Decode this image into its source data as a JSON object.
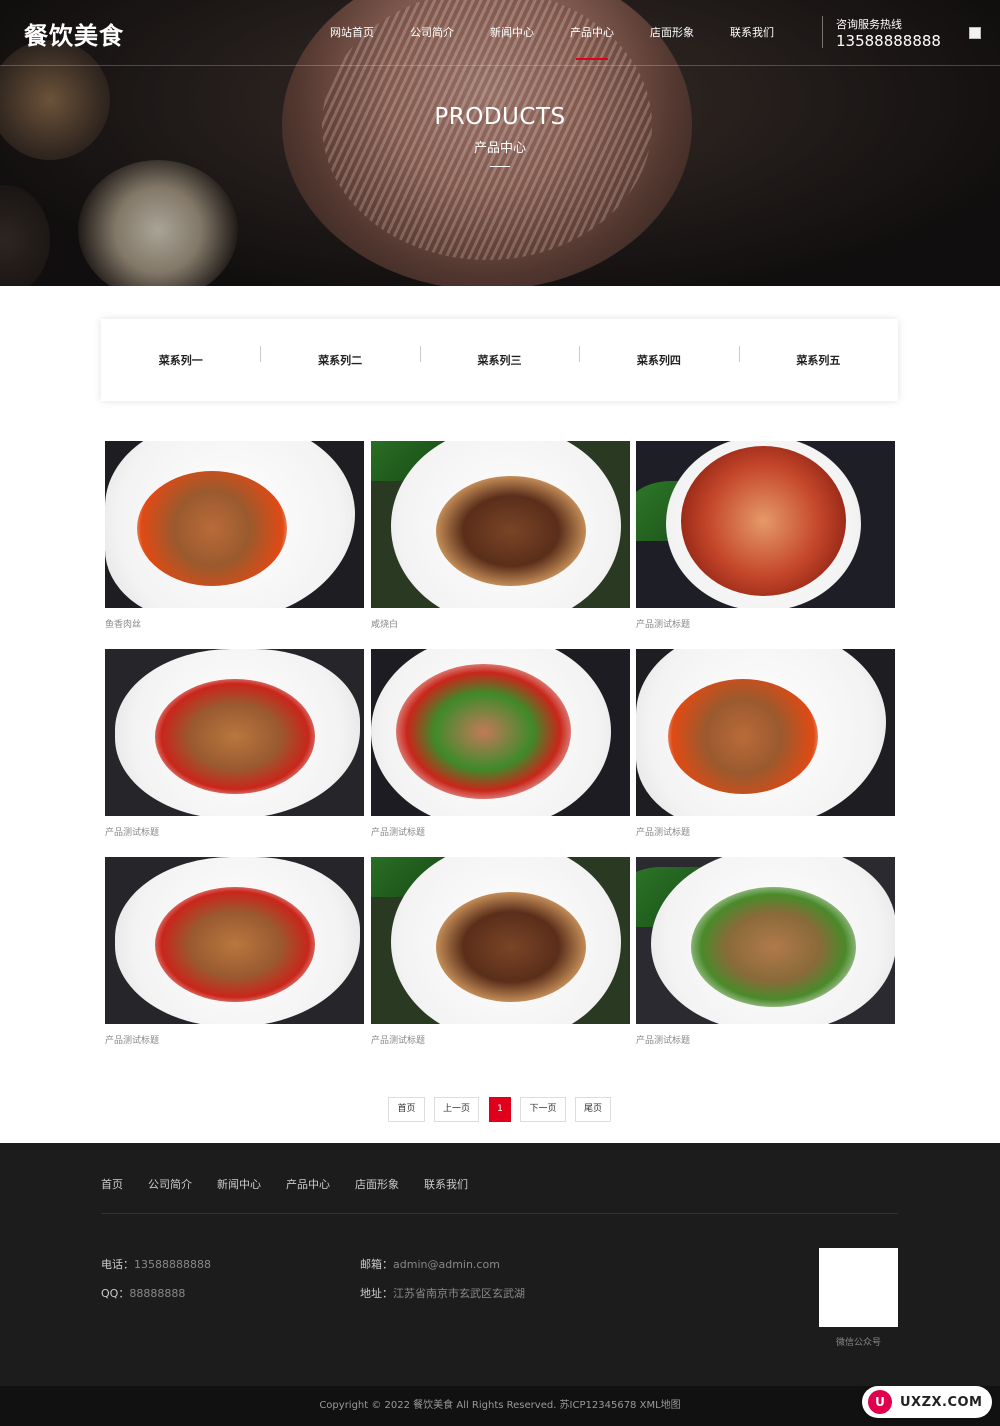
{
  "header": {
    "logo": "餐饮美食",
    "nav": [
      "网站首页",
      "公司简介",
      "新闻中心",
      "产品中心",
      "店面形象",
      "联系我们"
    ],
    "active_nav": "产品中心",
    "hotline_label": "咨询服务热线",
    "hotline_number": "13588888888"
  },
  "banner": {
    "title": "PRODUCTS",
    "subtitle": "产品中心"
  },
  "categories": [
    "菜系列一",
    "菜系列二",
    "菜系列三",
    "菜系列四",
    "菜系列五"
  ],
  "products": [
    {
      "title": "鱼香肉丝",
      "image": "shredded-pork-dish"
    },
    {
      "title": "咸烧白",
      "image": "braised-pork-belly-dish"
    },
    {
      "title": "产品测试标题",
      "image": "mapo-tofu-dish"
    },
    {
      "title": "产品测试标题",
      "image": "stir-fried-pork-peppers-dish"
    },
    {
      "title": "产品测试标题",
      "image": "pig-ear-peppers-dish"
    },
    {
      "title": "产品测试标题",
      "image": "shredded-pork-dish"
    },
    {
      "title": "产品测试标题",
      "image": "stir-fried-pork-peppers-dish"
    },
    {
      "title": "产品测试标题",
      "image": "braised-pork-belly-dish"
    },
    {
      "title": "产品测试标题",
      "image": "minced-pork-peppers-dish"
    }
  ],
  "pagination": {
    "first": "首页",
    "prev": "上一页",
    "current": "1",
    "next": "下一页",
    "last": "尾页"
  },
  "footer": {
    "nav": [
      "首页",
      "公司简介",
      "新闻中心",
      "产品中心",
      "店面形象",
      "联系我们"
    ],
    "phone_label": "电话：",
    "phone": "13588888888",
    "qq_label": "QQ：",
    "qq": "88888888",
    "email_label": "邮箱：",
    "email": "admin@admin.com",
    "address_label": "地址：",
    "address": "江苏省南京市玄武区玄武湖",
    "qr_label": "微信公众号",
    "copyright": "Copyright © 2022 餐饮美食 All Rights Reserved. 苏ICP12345678 XML地图"
  },
  "watermark": {
    "logo_letter": "U",
    "text": "UXZX.COM"
  },
  "colors": {
    "accent": "#e0001b",
    "footer_bg": "#1c1c1c"
  }
}
